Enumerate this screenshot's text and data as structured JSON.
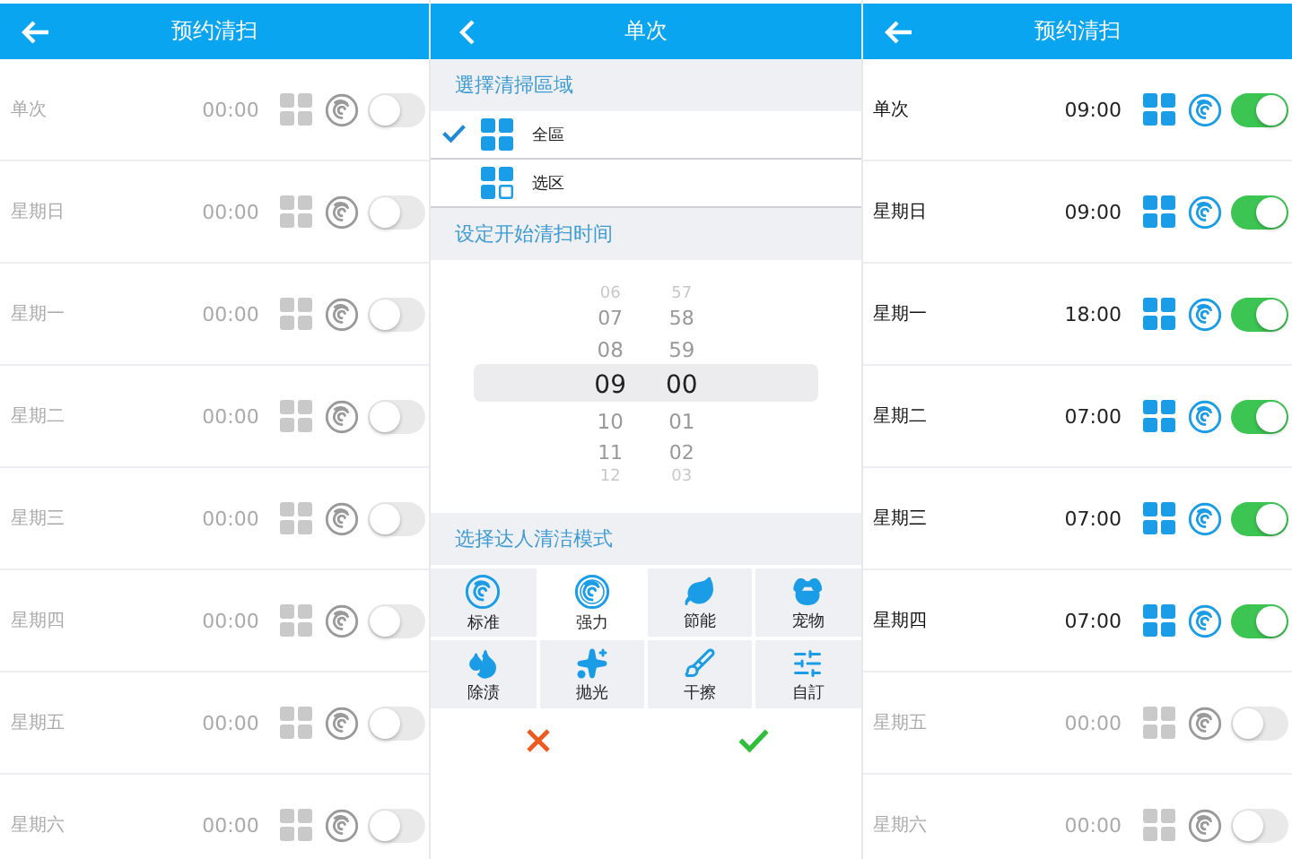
{
  "screens": [
    {
      "kind": "schedule",
      "title": "预约清扫",
      "rows": [
        {
          "day": "单次",
          "time": "00:00",
          "enabled": false
        },
        {
          "day": "星期日",
          "time": "00:00",
          "enabled": false
        },
        {
          "day": "星期一",
          "time": "00:00",
          "enabled": false
        },
        {
          "day": "星期二",
          "time": "00:00",
          "enabled": false
        },
        {
          "day": "星期三",
          "time": "00:00",
          "enabled": false
        },
        {
          "day": "星期四",
          "time": "00:00",
          "enabled": false
        },
        {
          "day": "星期五",
          "time": "00:00",
          "enabled": false
        },
        {
          "day": "星期六",
          "time": "00:00",
          "enabled": false
        }
      ]
    },
    {
      "kind": "editor",
      "title": "单次",
      "area_heading": "選擇清掃區域",
      "areas": [
        {
          "label": "全區",
          "selected": true
        },
        {
          "label": "选区",
          "selected": false
        }
      ],
      "time_heading": "设定开始清扫时间",
      "hours": [
        {
          "label": "06",
          "selected": false
        },
        {
          "label": "07",
          "selected": false
        },
        {
          "label": "08",
          "selected": false
        },
        {
          "label": "09",
          "selected": true
        },
        {
          "label": "10",
          "selected": false
        },
        {
          "label": "11",
          "selected": false
        },
        {
          "label": "12",
          "selected": false
        }
      ],
      "minutes": [
        {
          "label": "57",
          "selected": false
        },
        {
          "label": "58",
          "selected": false
        },
        {
          "label": "59",
          "selected": false
        },
        {
          "label": "00",
          "selected": true
        },
        {
          "label": "01",
          "selected": false
        },
        {
          "label": "02",
          "selected": false
        },
        {
          "label": "03",
          "selected": false
        }
      ],
      "mode_heading": "选择达人清洁模式",
      "modes": [
        {
          "label": "标准",
          "selected": false
        },
        {
          "label": "强力",
          "selected": true
        },
        {
          "label": "節能",
          "selected": false
        },
        {
          "label": "宠物",
          "selected": false
        },
        {
          "label": "除渍",
          "selected": false
        },
        {
          "label": "抛光",
          "selected": false
        },
        {
          "label": "干擦",
          "selected": false
        },
        {
          "label": "自訂",
          "selected": false
        }
      ]
    },
    {
      "kind": "schedule",
      "title": "预约清扫",
      "rows": [
        {
          "day": "单次",
          "time": "09:00",
          "enabled": true
        },
        {
          "day": "星期日",
          "time": "09:00",
          "enabled": true
        },
        {
          "day": "星期一",
          "time": "18:00",
          "enabled": true
        },
        {
          "day": "星期二",
          "time": "07:00",
          "enabled": true
        },
        {
          "day": "星期三",
          "time": "07:00",
          "enabled": true
        },
        {
          "day": "星期四",
          "time": "07:00",
          "enabled": true
        },
        {
          "day": "星期五",
          "time": "00:00",
          "enabled": false
        },
        {
          "day": "星期六",
          "time": "00:00",
          "enabled": false
        }
      ]
    }
  ]
}
